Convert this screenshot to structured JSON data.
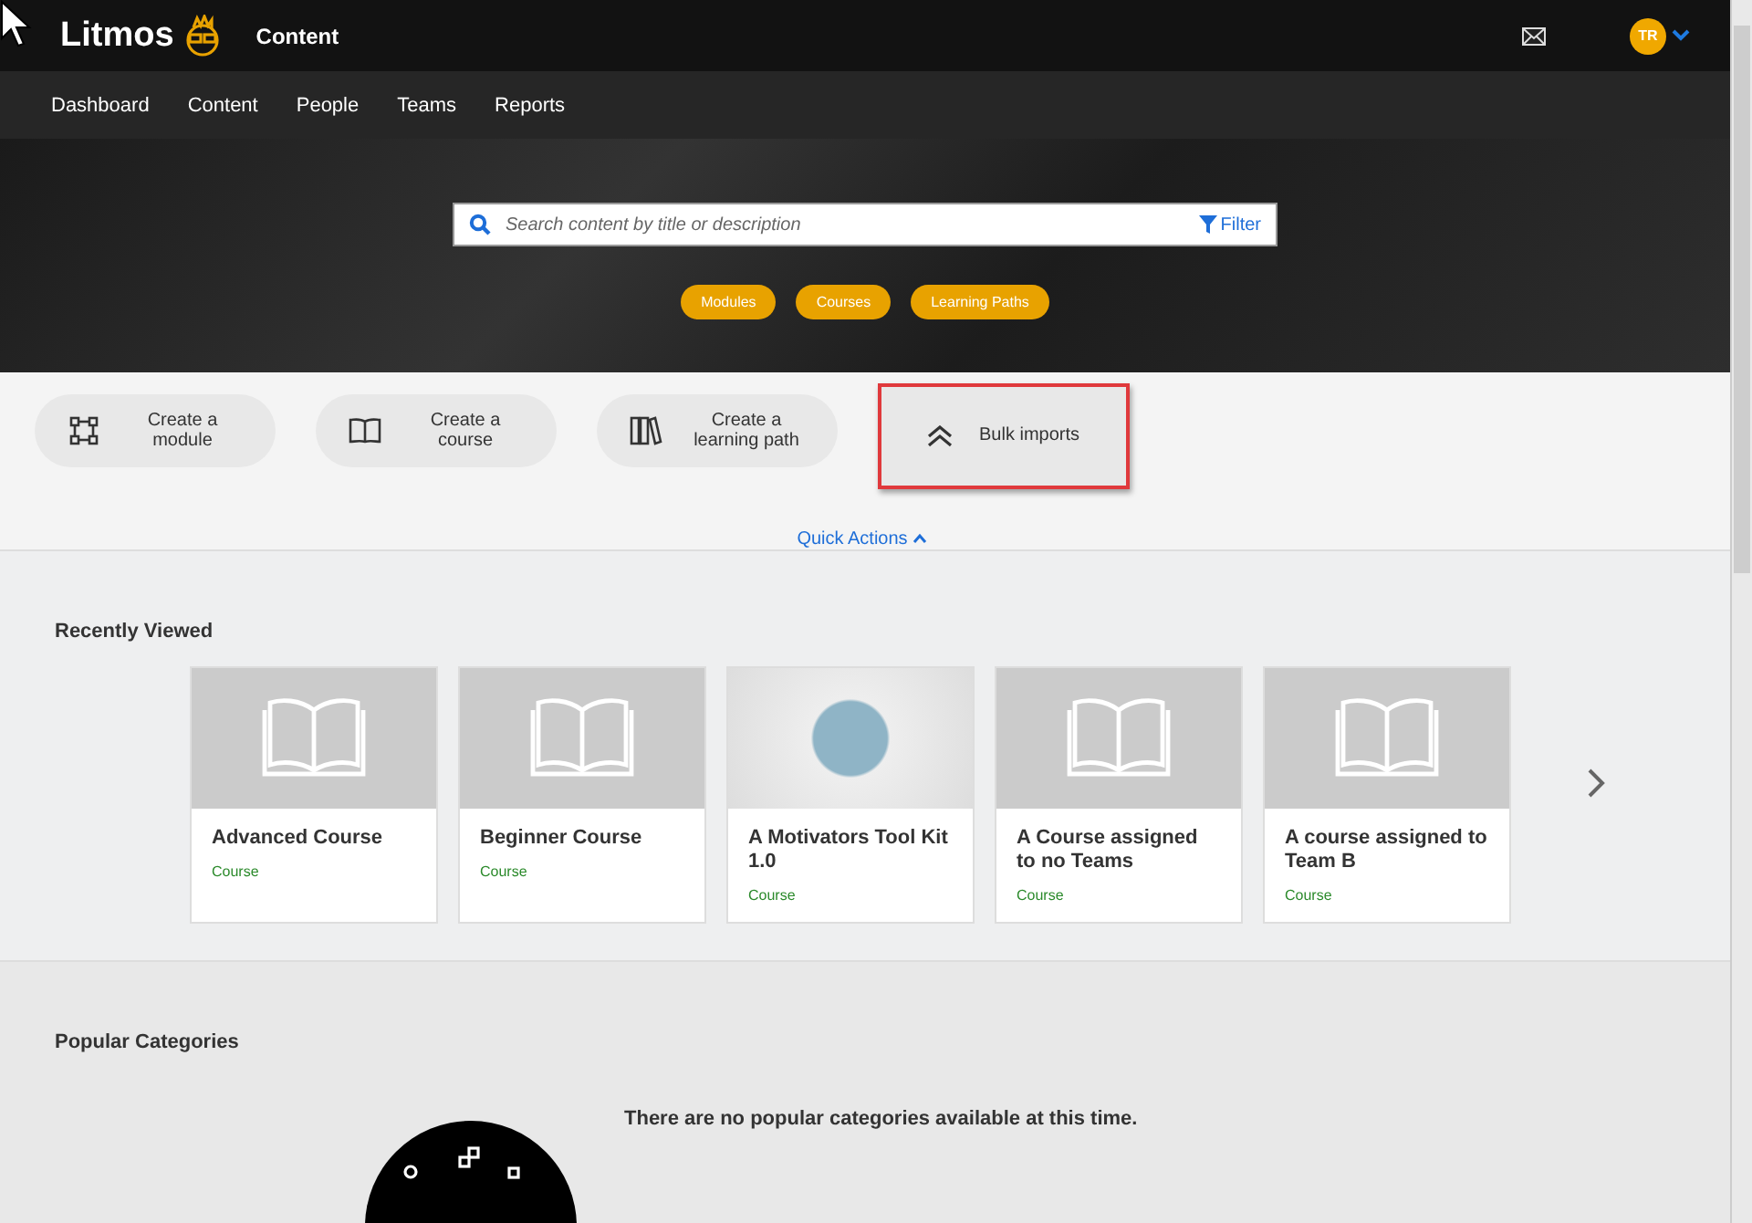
{
  "header": {
    "logo": "Litmos",
    "section_title": "Content",
    "avatar_initials": "TR"
  },
  "nav": [
    {
      "label": "Dashboard"
    },
    {
      "label": "Content"
    },
    {
      "label": "People"
    },
    {
      "label": "Teams"
    },
    {
      "label": "Reports"
    }
  ],
  "search": {
    "placeholder": "Search content by title or description",
    "filter_label": "Filter"
  },
  "content_types": [
    {
      "label": "Modules"
    },
    {
      "label": "Courses"
    },
    {
      "label": "Learning Paths"
    }
  ],
  "quick_actions": {
    "items": [
      {
        "kind": "module",
        "label": "Create a module",
        "highlighted": false
      },
      {
        "kind": "course",
        "label": "Create a course",
        "highlighted": false
      },
      {
        "kind": "path",
        "label": "Create a learning path",
        "highlighted": false
      },
      {
        "kind": "bulk",
        "label": "Bulk imports",
        "highlighted": true
      }
    ],
    "toggle_label": "Quick Actions",
    "expanded": true
  },
  "recently_viewed": {
    "title": "Recently Viewed",
    "cards": [
      {
        "kind": "book",
        "title": "Advanced Course",
        "type": "Course"
      },
      {
        "kind": "book",
        "title": "Beginner Course",
        "type": "Course"
      },
      {
        "kind": "photo",
        "title": "A Motivators Tool Kit 1.0",
        "type": "Course"
      },
      {
        "kind": "book",
        "title": "A Course assigned to no Teams",
        "type": "Course"
      },
      {
        "kind": "book",
        "title": "A course assigned to Team B",
        "type": "Course"
      }
    ]
  },
  "popular_categories": {
    "title": "Popular Categories",
    "message": "There are no popular categories available at this time."
  }
}
